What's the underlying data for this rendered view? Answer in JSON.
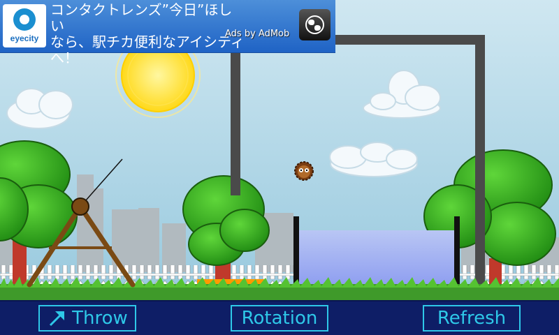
{
  "ad": {
    "logo_text": "eyecity",
    "lines": [
      "コンタクトレンズ”今日”ほしい",
      "なら、駅チカ便利なアイシティ",
      "へ！"
    ],
    "attribution": "Ads by AdMob",
    "icon": "globe-icon"
  },
  "game": {
    "objects": [
      "sun",
      "clouds",
      "trees",
      "city-skyline",
      "picket-fence",
      "catapult",
      "hedgehog",
      "gallows-frame",
      "water-tank",
      "orange-target-platform"
    ],
    "colors": {
      "sky": "#a9d2e4",
      "water": "#9aabf2",
      "grass": "#3f9a2a",
      "toolbar": "#0e1e66",
      "button": "#2ec8e8",
      "target": "#ff9a00"
    }
  },
  "toolbar": {
    "throw_label": "Throw",
    "rotation_label": "Rotation",
    "refresh_label": "Refresh",
    "throw_icon": "arrow-up-right-icon"
  }
}
